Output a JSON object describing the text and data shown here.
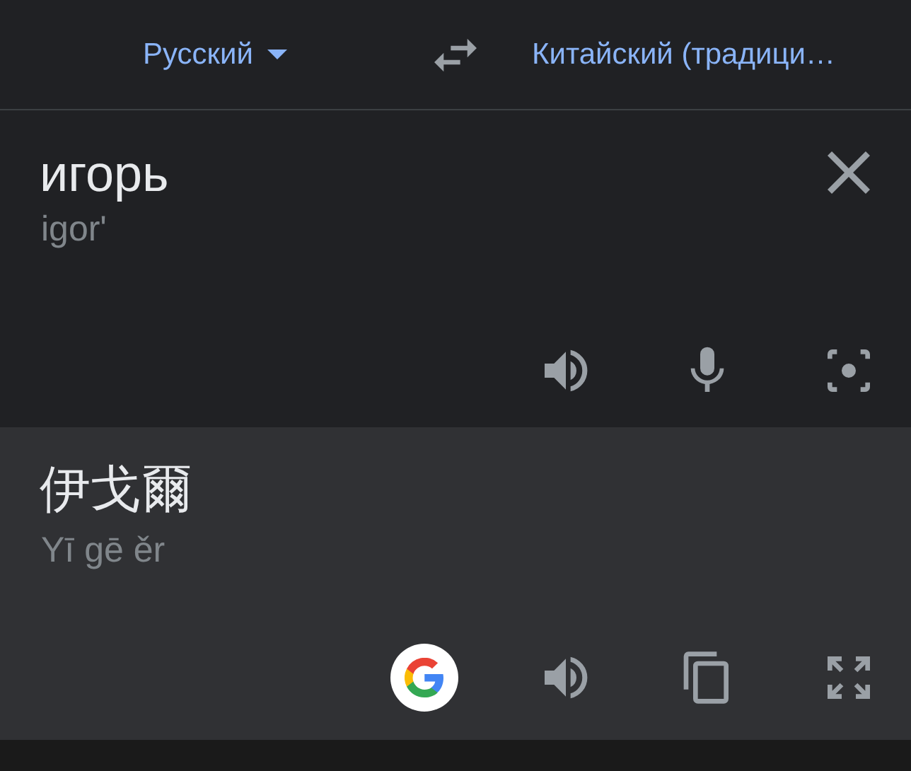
{
  "languages": {
    "source": "Русский",
    "target": "Китайский (традици…"
  },
  "input": {
    "text": "игорь",
    "transliteration": "igor'"
  },
  "output": {
    "text": "伊戈爾",
    "romanization": "Yī gē ěr"
  }
}
